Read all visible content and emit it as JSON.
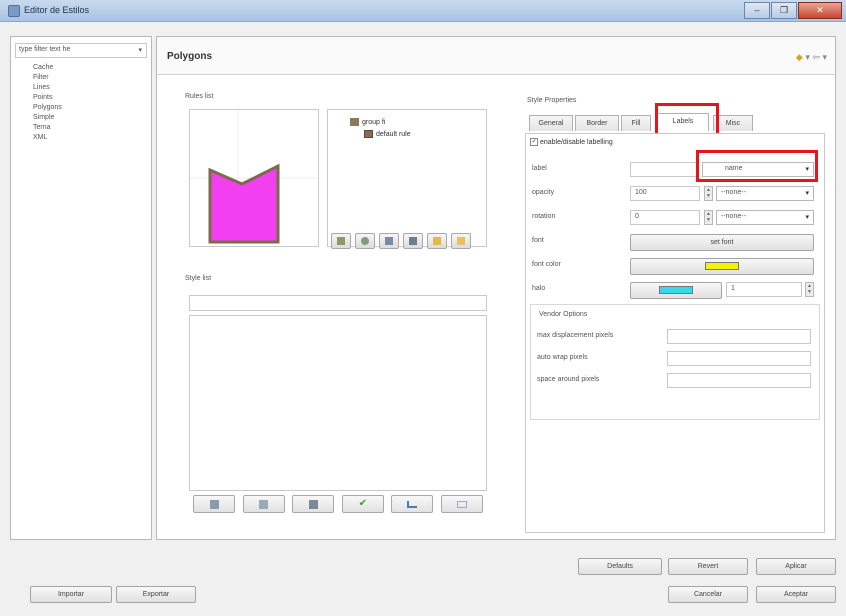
{
  "window": {
    "title": "Editor de Estilos",
    "controls": [
      "–",
      "❐",
      "✕"
    ]
  },
  "left": {
    "layer_combo": "type filter text he",
    "items": [
      "Cache",
      "Filter",
      "Lines",
      "Points",
      "Polygons",
      "Simple",
      "Terna",
      "XML"
    ]
  },
  "header": {
    "title": "Polygons",
    "icons": [
      "◆",
      "▾",
      "⇦",
      "▾"
    ]
  },
  "rules": {
    "label": "Rules list",
    "group": "group fi",
    "rule": "default rule",
    "preview_color": "#f23ff0"
  },
  "style_list": {
    "label": "Style list"
  },
  "props": {
    "title": "Style Properties",
    "tabs": [
      "General",
      "Border",
      "Fill",
      "Labels",
      "Misc"
    ],
    "active_tab": "Labels",
    "enable_label": "enable/disable labelling",
    "rows": {
      "label": {
        "name": "label",
        "value": "name"
      },
      "opacity": {
        "name": "opacity",
        "value": "100",
        "combo": "--none--"
      },
      "rotation": {
        "name": "rotation",
        "value": "0",
        "combo": "--none--"
      },
      "font": {
        "name": "font",
        "button": "set font"
      },
      "font_color": {
        "name": "font color",
        "swatch": "#f7f300"
      },
      "halo": {
        "name": "halo",
        "swatch": "#37d8e8",
        "value": "1"
      }
    },
    "vendor": {
      "title": "Vendor Options",
      "rows": [
        "max displacement pixels",
        "auto wrap pixels",
        "space around pixels"
      ]
    }
  },
  "buttons": {
    "defaults": "Defaults",
    "revert": "Revert",
    "apply": "Aplicar",
    "cancel": "Cancelar",
    "accept": "Aceptar",
    "import": "Importar",
    "export": "Exportar"
  }
}
